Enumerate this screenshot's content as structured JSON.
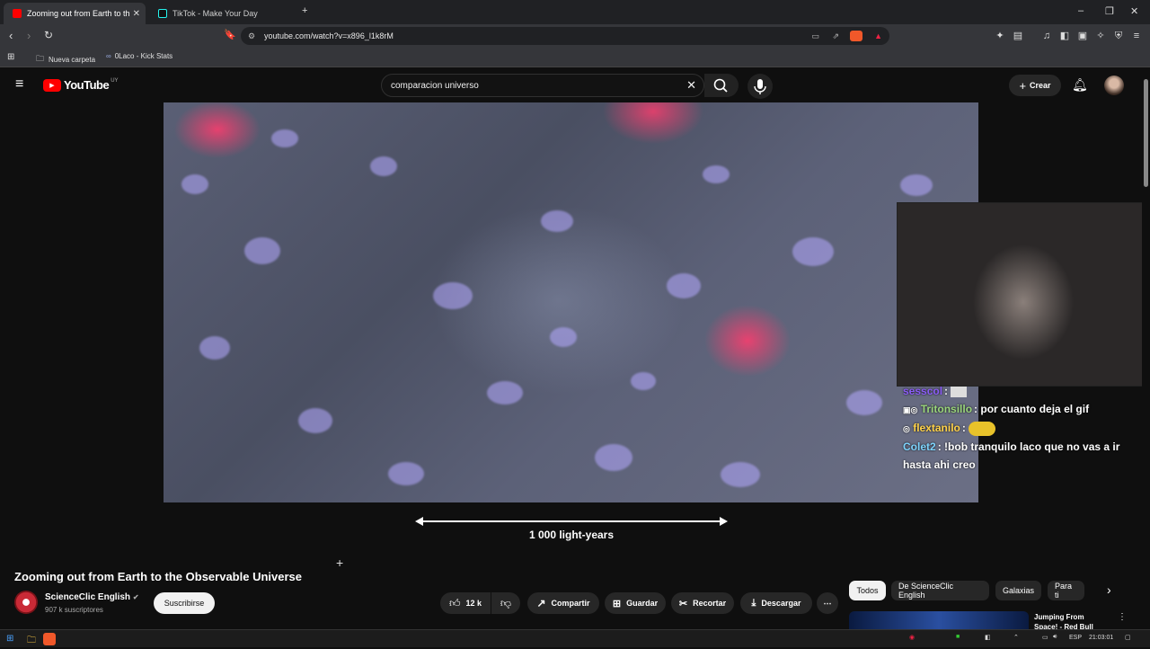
{
  "browser": {
    "tabs": [
      {
        "label": "Zooming out from Earth to th",
        "active": true
      },
      {
        "label": "TikTok - Make Your Day",
        "active": false
      }
    ],
    "url": "youtube.com/watch?v=x896_l1k8rM",
    "bookmarks": [
      "Nueva carpeta",
      "0Laco - Kick Stats"
    ]
  },
  "youtube": {
    "logo": "YouTube",
    "country": "UY",
    "search_value": "comparacion universo",
    "create_label": "Crear"
  },
  "video": {
    "scale_label": "1 000 light-years",
    "title": "Zooming out from Earth to the Observable Universe",
    "channel": "ScienceClic English",
    "subscribers": "907 k suscriptores",
    "subscribe_label": "Suscribirse",
    "likes": "12 k",
    "share_label": "Compartir",
    "save_label": "Guardar",
    "clip_label": "Recortar",
    "download_label": "Descargar"
  },
  "chat": [
    {
      "user": "sesscol",
      "text": "",
      "color": "#8b5cf6"
    },
    {
      "user": "Tritonsillo",
      "text": "por cuanto deja el gif",
      "color": "#9bd67c"
    },
    {
      "user": "flextanilo",
      "text": "",
      "color": "#ffd24a"
    },
    {
      "user": "Colet2",
      "text": "!bob tranquilo laco que no vas a ir hasta ahi creo",
      "color": "#7dd3fc"
    }
  ],
  "chips": [
    "Todos",
    "De ScienceClic English",
    "Galaxias",
    "Para ti"
  ],
  "recommendation": {
    "title": "Jumping From Space! - Red Bull"
  },
  "taskbar": {
    "lang": "ESP",
    "time": "21:03:01"
  },
  "colors": {
    "youtube_red": "#ff0000",
    "background": "#0f0f0f",
    "chip_bg": "#272727"
  }
}
